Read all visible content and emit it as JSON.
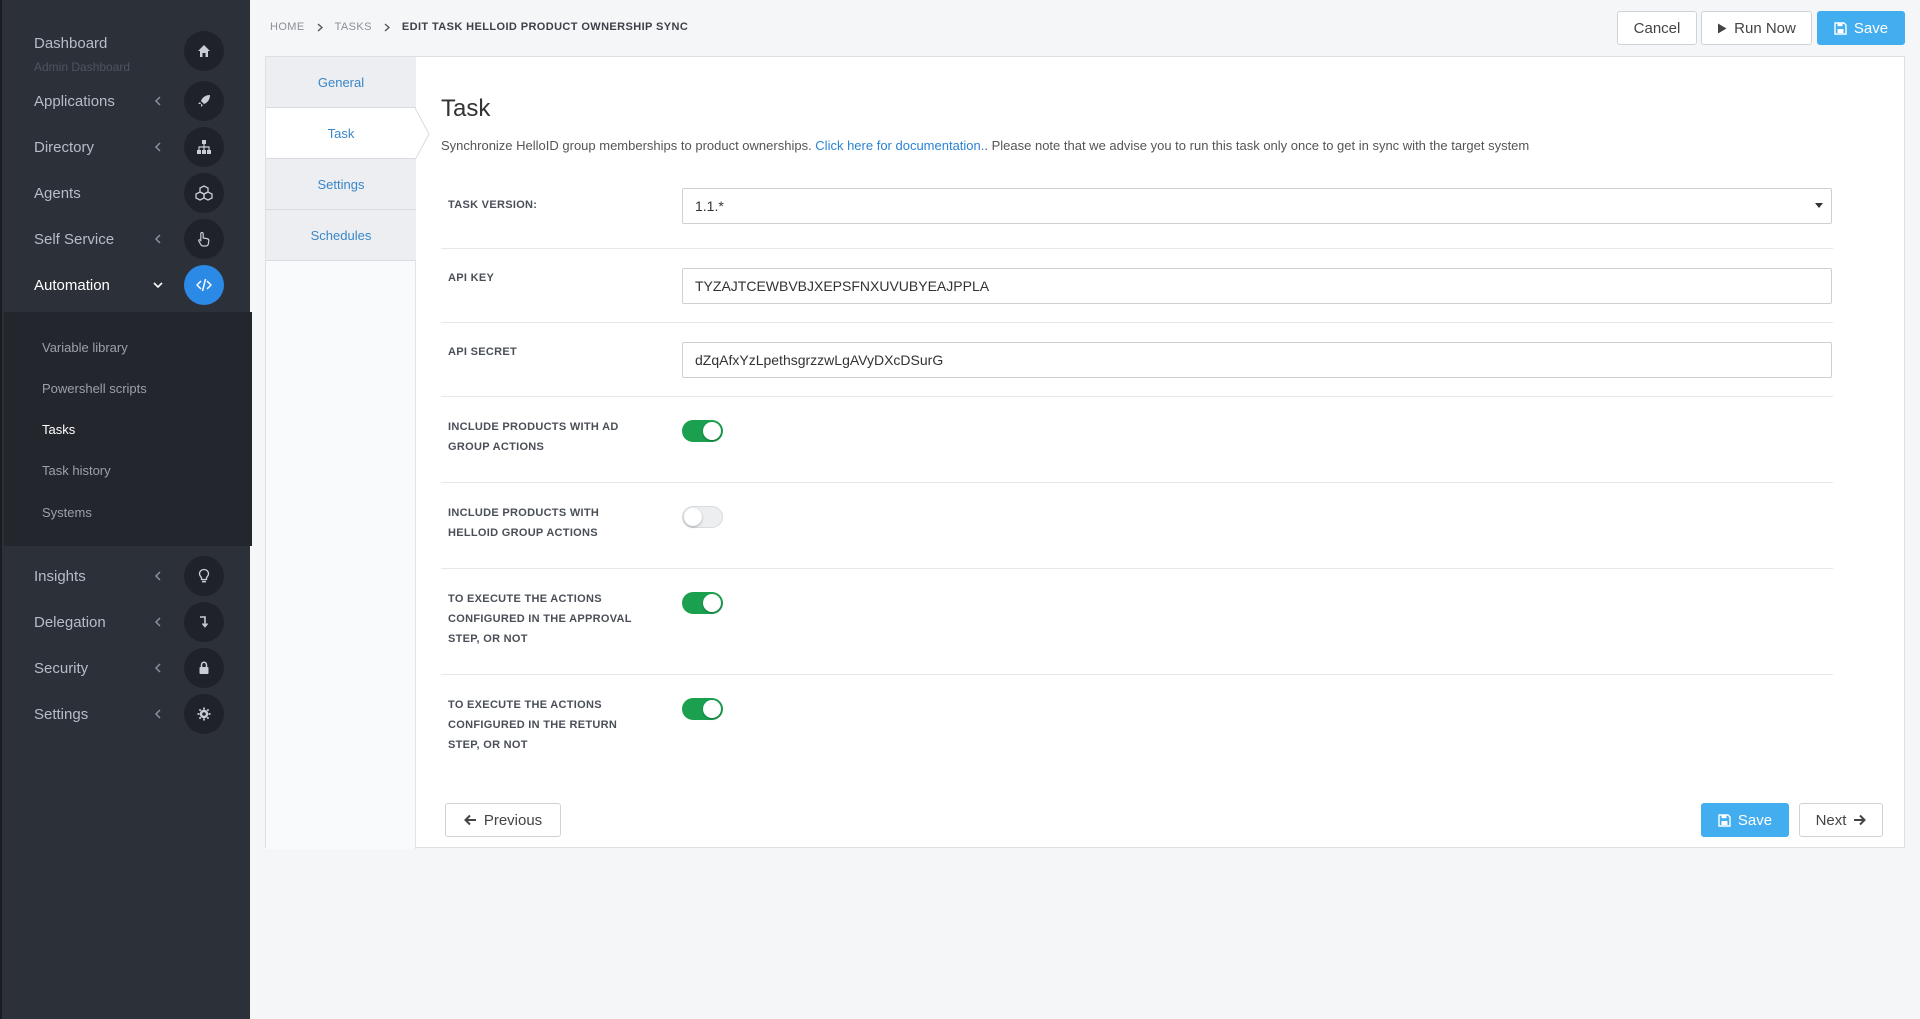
{
  "sidebar": {
    "dashboard": {
      "label": "Dashboard",
      "sublabel": "Admin Dashboard"
    },
    "items": [
      {
        "label": "Applications"
      },
      {
        "label": "Directory"
      },
      {
        "label": "Agents"
      },
      {
        "label": "Self Service"
      },
      {
        "label": "Automation"
      },
      {
        "label": "Insights"
      },
      {
        "label": "Delegation"
      },
      {
        "label": "Security"
      },
      {
        "label": "Settings"
      }
    ],
    "subnav": [
      {
        "label": "Variable library"
      },
      {
        "label": "Powershell scripts"
      },
      {
        "label": "Tasks"
      },
      {
        "label": "Task history"
      },
      {
        "label": "Systems"
      }
    ]
  },
  "breadcrumb": {
    "home": "HOME",
    "tasks": "TASKS",
    "current": "EDIT TASK HELLOID PRODUCT OWNERSHIP SYNC"
  },
  "toolbar": {
    "cancel": "Cancel",
    "run_now": "Run Now",
    "save": "Save"
  },
  "tabs": [
    {
      "label": "General"
    },
    {
      "label": "Task"
    },
    {
      "label": "Settings"
    },
    {
      "label": "Schedules"
    }
  ],
  "main": {
    "title": "Task",
    "desc_before": "Synchronize HelloID group memberships to product ownerships. ",
    "desc_link": "Click here for documentation.",
    "desc_after": ". Please note that we advise you to run this task only once to get in sync with the target system"
  },
  "form": {
    "task_version": {
      "label": "TASK VERSION:",
      "value": "1.1.*"
    },
    "api_key": {
      "label": "API KEY",
      "value": "TYZAJTCEWBVBJXEPSFNXUVUBYEAJPPLA"
    },
    "api_secret": {
      "label": "API SECRET",
      "value": "dZqAfxYzLpethsgrzzwLgAVyDXcDSurG"
    },
    "include_ad": {
      "label": "INCLUDE PRODUCTS WITH AD GROUP ACTIONS",
      "on": true
    },
    "include_helloid": {
      "label": "INCLUDE PRODUCTS WITH HELLOID GROUP ACTIONS",
      "on": false
    },
    "execute_approval": {
      "label": "TO EXECUTE THE ACTIONS CONFIGURED IN THE APPROVAL STEP, OR NOT",
      "on": true
    },
    "execute_return": {
      "label": "TO EXECUTE THE ACTIONS CONFIGURED IN THE RETURN STEP, OR NOT",
      "on": true
    }
  },
  "footer": {
    "previous": "Previous",
    "save": "Save",
    "next": "Next"
  },
  "colors": {
    "accent": "#42aef0",
    "toggle_on": "#1aa04f",
    "sidebar_bg": "#2c3039",
    "link": "#2b83d6"
  }
}
